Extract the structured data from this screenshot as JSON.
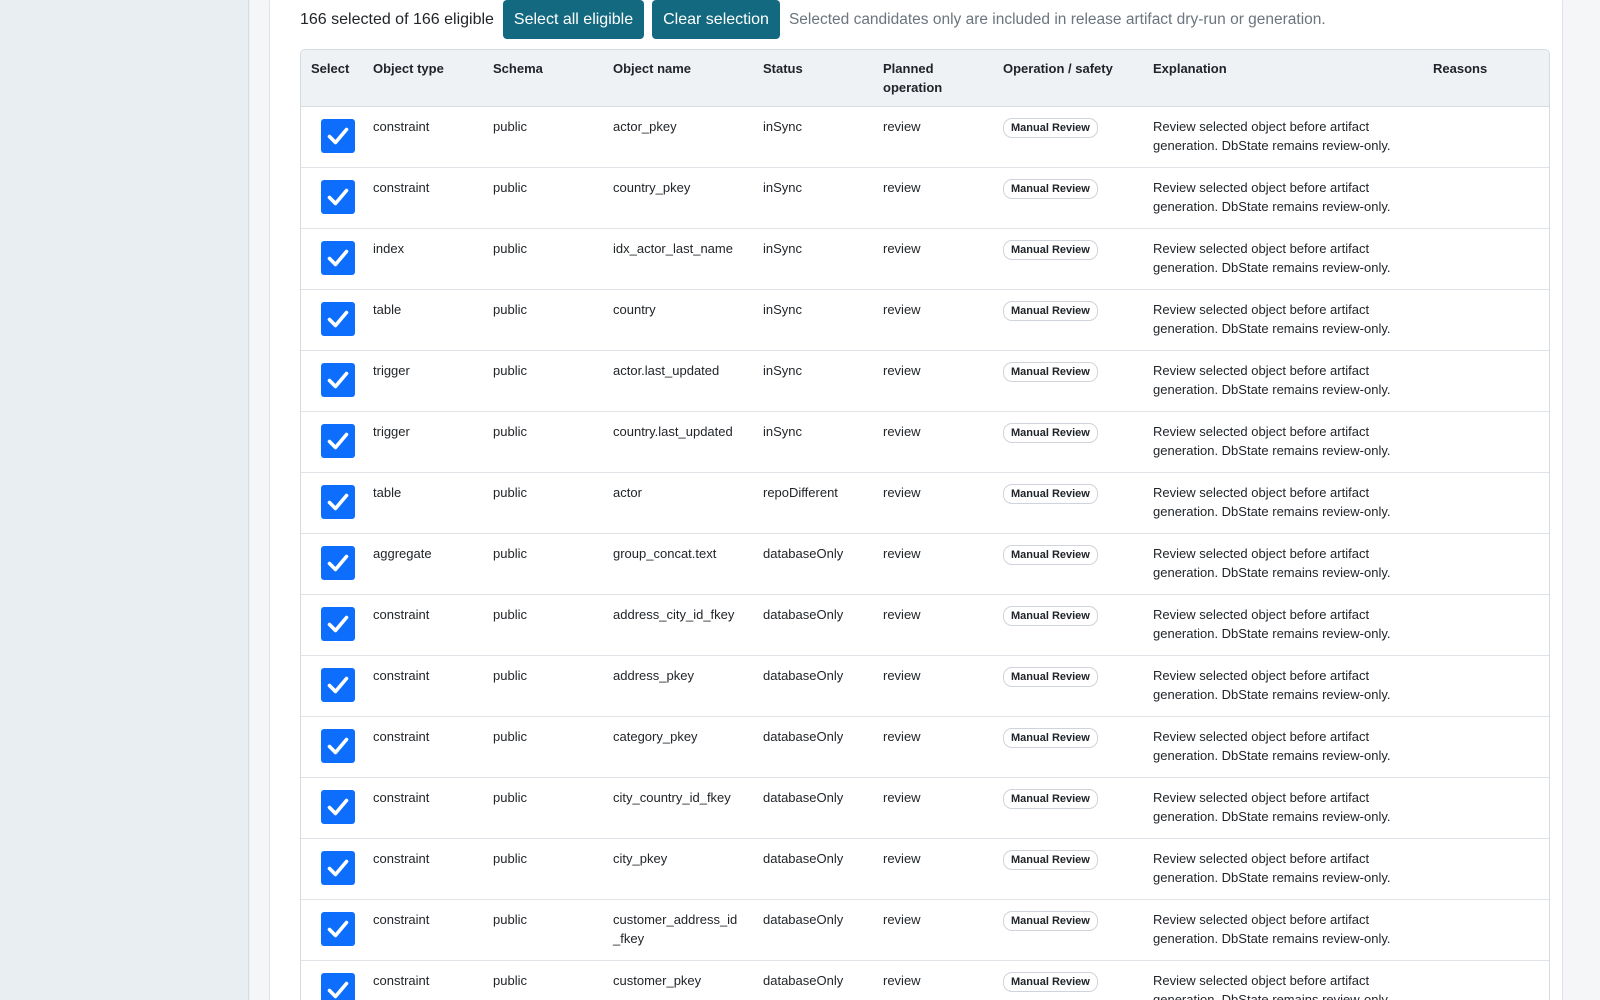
{
  "toolbar": {
    "selection_summary": "166 selected of 166 eligible",
    "select_all_label": "Select all eligible",
    "clear_label": "Clear selection",
    "note": "Selected candidates only are included in release artifact dry-run or generation."
  },
  "table": {
    "columns": [
      "Select",
      "Object type",
      "Schema",
      "Object name",
      "Status",
      "Planned operation",
      "Operation / safety",
      "Explanation",
      "Reasons"
    ],
    "rows": [
      {
        "type": "constraint",
        "schema": "public",
        "name": "actor_pkey",
        "status": "inSync",
        "op": "review",
        "safety": "Manual Review",
        "explanation": "Review selected object before artifact generation. DbState remains review-only.",
        "reasons": ""
      },
      {
        "type": "constraint",
        "schema": "public",
        "name": "country_pkey",
        "status": "inSync",
        "op": "review",
        "safety": "Manual Review",
        "explanation": "Review selected object before artifact generation. DbState remains review-only.",
        "reasons": ""
      },
      {
        "type": "index",
        "schema": "public",
        "name": "idx_actor_last_name",
        "status": "inSync",
        "op": "review",
        "safety": "Manual Review",
        "explanation": "Review selected object before artifact generation. DbState remains review-only.",
        "reasons": ""
      },
      {
        "type": "table",
        "schema": "public",
        "name": "country",
        "status": "inSync",
        "op": "review",
        "safety": "Manual Review",
        "explanation": "Review selected object before artifact generation. DbState remains review-only.",
        "reasons": ""
      },
      {
        "type": "trigger",
        "schema": "public",
        "name": "actor.last_updated",
        "status": "inSync",
        "op": "review",
        "safety": "Manual Review",
        "explanation": "Review selected object before artifact generation. DbState remains review-only.",
        "reasons": ""
      },
      {
        "type": "trigger",
        "schema": "public",
        "name": "country.last_updated",
        "status": "inSync",
        "op": "review",
        "safety": "Manual Review",
        "explanation": "Review selected object before artifact generation. DbState remains review-only.",
        "reasons": ""
      },
      {
        "type": "table",
        "schema": "public",
        "name": "actor",
        "status": "repoDifferent",
        "op": "review",
        "safety": "Manual Review",
        "explanation": "Review selected object before artifact generation. DbState remains review-only.",
        "reasons": ""
      },
      {
        "type": "aggregate",
        "schema": "public",
        "name": "group_concat.text",
        "status": "databaseOnly",
        "op": "review",
        "safety": "Manual Review",
        "explanation": "Review selected object before artifact generation. DbState remains review-only.",
        "reasons": ""
      },
      {
        "type": "constraint",
        "schema": "public",
        "name": "address_city_id_fkey",
        "status": "databaseOnly",
        "op": "review",
        "safety": "Manual Review",
        "explanation": "Review selected object before artifact generation. DbState remains review-only.",
        "reasons": ""
      },
      {
        "type": "constraint",
        "schema": "public",
        "name": "address_pkey",
        "status": "databaseOnly",
        "op": "review",
        "safety": "Manual Review",
        "explanation": "Review selected object before artifact generation. DbState remains review-only.",
        "reasons": ""
      },
      {
        "type": "constraint",
        "schema": "public",
        "name": "category_pkey",
        "status": "databaseOnly",
        "op": "review",
        "safety": "Manual Review",
        "explanation": "Review selected object before artifact generation. DbState remains review-only.",
        "reasons": ""
      },
      {
        "type": "constraint",
        "schema": "public",
        "name": "city_country_id_fkey",
        "status": "databaseOnly",
        "op": "review",
        "safety": "Manual Review",
        "explanation": "Review selected object before artifact generation. DbState remains review-only.",
        "reasons": ""
      },
      {
        "type": "constraint",
        "schema": "public",
        "name": "city_pkey",
        "status": "databaseOnly",
        "op": "review",
        "safety": "Manual Review",
        "explanation": "Review selected object before artifact generation. DbState remains review-only.",
        "reasons": ""
      },
      {
        "type": "constraint",
        "schema": "public",
        "name": "customer_address_id_fkey",
        "status": "databaseOnly",
        "op": "review",
        "safety": "Manual Review",
        "explanation": "Review selected object before artifact generation. DbState remains review-only.",
        "reasons": ""
      },
      {
        "type": "constraint",
        "schema": "public",
        "name": "customer_pkey",
        "status": "databaseOnly",
        "op": "review",
        "safety": "Manual Review",
        "explanation": "Review selected object before artifact generation. DbState remains review-only.",
        "reasons": ""
      }
    ]
  },
  "colors": {
    "button_bg": "#13697f",
    "checkbox_bg": "#0d6efd",
    "header_bg": "#eef2f5",
    "sidebar_bg": "#e9eef2"
  }
}
